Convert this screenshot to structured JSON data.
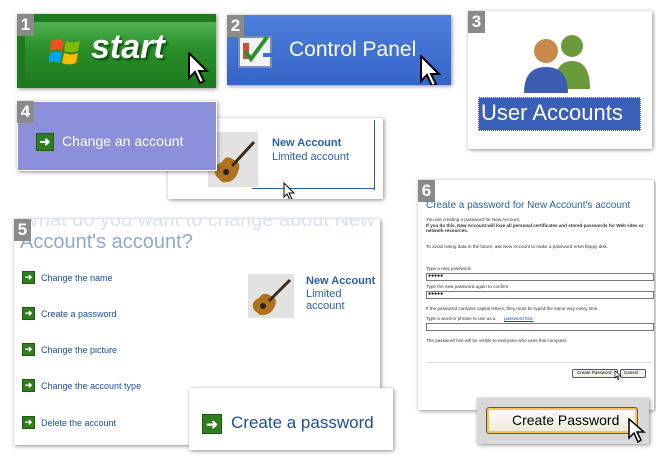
{
  "colors": {
    "xp_green": "#2b8f2b",
    "xp_blue": "#3a6fd1",
    "link_blue": "#1d4fa0",
    "heading_blue": "#2a5fae",
    "lavender": "#8b8ed8"
  },
  "steps": [
    {
      "number": "1",
      "start_label": "start"
    },
    {
      "number": "2",
      "label": "Control Panel"
    },
    {
      "number": "3",
      "label": "User Accounts"
    },
    {
      "number": "4",
      "change_account_label": "Change an account",
      "account_name": "New Account",
      "account_type": "Limited account"
    },
    {
      "number": "5",
      "heading_top": "What do you want to change about New",
      "heading": "Account's account?",
      "links": [
        "Change the name",
        "Create a password",
        "Change the picture",
        "Change the account type",
        "Delete the account"
      ],
      "account_name": "New Account",
      "account_type": "Limited account",
      "zoom_link": "Create a password"
    },
    {
      "number": "6",
      "title": "Create a password for New Account's account",
      "intro_1": "You are creating a password for New Account.",
      "intro_bold": "If you do this, New Account will lose all personal certificates and stored passwords for Web sites or network resources.",
      "intro_2": "To avoid losing data in the future, ask New Account to make a password reset floppy disk.",
      "new_password_label": "Type a new password:",
      "new_password_value": "●●●●●",
      "confirm_label": "Type the new password again to confirm:",
      "confirm_value": "●●●●●",
      "caps_note": "If the password contains capital letters, they must be typed the same way every time.",
      "hint_label": "Type a word or phrase to use as a",
      "hint_link": "password hint.",
      "hint_note": "The password hint will be visible to everyone who uses this computer.",
      "create_button": "Create Password",
      "cancel_button": "Cancel",
      "zoom_button": "Create Password"
    }
  ]
}
